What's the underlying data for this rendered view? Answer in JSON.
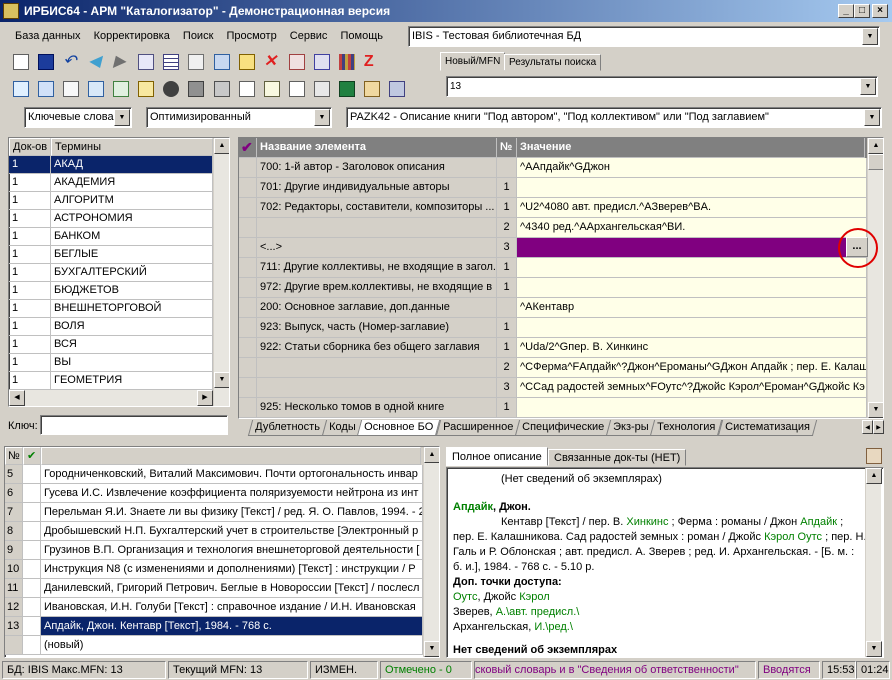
{
  "window": {
    "title": "ИРБИС64 - АРМ \"Каталогизатор\" - Демонстрационная версия",
    "min": "_",
    "max": "□",
    "close": "×"
  },
  "menu": [
    "База данных",
    "Корректировка",
    "Поиск",
    "Просмотр",
    "Сервис",
    "Помощь"
  ],
  "db_selector": {
    "value": "IBIS - Тестовая библиотечная БД"
  },
  "right_tabs": {
    "items": [
      "Новый/MFN",
      "Результаты поиска"
    ]
  },
  "mfn_input": {
    "value": "13"
  },
  "search_bar": {
    "mode": "Ключевые слова",
    "option": "Оптимизированный",
    "worksheet": "PAZK42 - Описание книги \"Под автором\", \"Под коллективом\" или \"Под заглавием\""
  },
  "dictionary": {
    "headers": {
      "count": "Док-ов",
      "terms": "Термины"
    },
    "rows": [
      {
        "count": "1",
        "term": "АКАД"
      },
      {
        "count": "1",
        "term": "АКАДЕМИЯ"
      },
      {
        "count": "1",
        "term": "АЛГОРИТМ"
      },
      {
        "count": "1",
        "term": "АСТРОНОМИЯ"
      },
      {
        "count": "1",
        "term": "БАНКОМ"
      },
      {
        "count": "1",
        "term": "БЕГЛЫЕ"
      },
      {
        "count": "1",
        "term": "БУХГАЛТЕРСКИЙ"
      },
      {
        "count": "1",
        "term": "БЮДЖЕТОВ"
      },
      {
        "count": "1",
        "term": "ВНЕШНЕТОРГОВОЙ"
      },
      {
        "count": "1",
        "term": "ВОЛЯ"
      },
      {
        "count": "1",
        "term": "ВСЯ"
      },
      {
        "count": "1",
        "term": "ВЫ"
      },
      {
        "count": "1",
        "term": "ГЕОМЕТРИЯ"
      }
    ],
    "key_label": "Ключ:",
    "key_value": ""
  },
  "editor": {
    "headers": {
      "check": "✔",
      "name": "Название элемента",
      "num": "№",
      "value": "Значение"
    },
    "rows": [
      {
        "name": "700: 1-й автор - Заголовок описания",
        "num": "",
        "value": "^AАпдайк^GДжон"
      },
      {
        "name": "701: Другие индивидуальные авторы",
        "num": "1",
        "value": ""
      },
      {
        "name": "702: Редакторы, составители, композиторы ...",
        "num": "1",
        "value": "^U2^4080 авт. предисл.^AЗверев^BA."
      },
      {
        "name": "",
        "num": "2",
        "value": "^4340 ред.^AАрхангельская^BИ."
      },
      {
        "name": "<...>",
        "num": "3",
        "value": ""
      },
      {
        "name": "711: Другие коллективы, не входящие в загол...",
        "num": "1",
        "value": ""
      },
      {
        "name": "972: Другие врем.коллективы, не входящие в ...",
        "num": "1",
        "value": ""
      },
      {
        "name": "200: Основное заглавие, доп.данные",
        "num": "",
        "value": "^AКентавр"
      },
      {
        "name": "923: Выпуск, часть (Номер-заглавие)",
        "num": "1",
        "value": ""
      },
      {
        "name": "922: Статьи сборника без общего заглавия",
        "num": "1",
        "value": "^Uda/2^Gпер. В. Хинкинс"
      },
      {
        "name": "",
        "num": "2",
        "value": "^CФерма^FАпдайк^?Джон^Eроманы^GДжон Апдайк ; пер. Е. Калашн"
      },
      {
        "name": "",
        "num": "3",
        "value": "^CСад радостей земных^FОутс^?Джойс Кэрол^Eроман^GДжойс Кэ"
      },
      {
        "name": "925: Несколько томов в одной книге",
        "num": "1",
        "value": ""
      }
    ],
    "ellipsis_button": "...",
    "tabs": [
      "Дублетность",
      "Коды",
      "Основное БО",
      "Расширенное",
      "Специфические",
      "Экз-ры",
      "Технология",
      "Систематизация"
    ],
    "active_tab": "Основное БО"
  },
  "results": {
    "headers": {
      "num": "№",
      "check": "✔"
    },
    "rows": [
      {
        "num": "5",
        "text": "Городниченковский, Виталий Максимович. Почти ортогональность инвар"
      },
      {
        "num": "6",
        "text": "Гусева И.С. Извлечение коэффициента поляризуемости нейтрона из инт"
      },
      {
        "num": "7",
        "text": "Перельман Я.И. Знаете ли вы физику [Текст] / ред. Я. О. Павлов, 1994. - 2"
      },
      {
        "num": "8",
        "text": "Дробышевский Н.П. Бухгалтерский учет в строительстве [Электронный р"
      },
      {
        "num": "9",
        "text": "Грузинов В.П. Организация и технология внешнеторговой деятельности ["
      },
      {
        "num": "10",
        "text": "Инструкция N8  (с изменениями и дополнениями) [Текст] : инструкции / Р"
      },
      {
        "num": "11",
        "text": "Данилевский, Григорий Петрович. Беглые в Новороссии [Текст] / послесл"
      },
      {
        "num": "12",
        "text": "Ивановская, И.Н. Голуби [Текст] : справочное издание / И.Н. Ивановская"
      },
      {
        "num": "13",
        "text": "Апдайк, Джон. Кентавр [Текст], 1984. - 768 с."
      },
      {
        "num": "",
        "text": "(новый)"
      }
    ],
    "selected_index": 8
  },
  "description": {
    "tabs": [
      "Полное описание",
      "Связанные док-ты (НЕТ)"
    ],
    "no_copies": "(Нет сведений об экземплярах)",
    "author_head": "Апдайк",
    "author_first": ", Джон.",
    "l1a": "Кентавр [Текст] / пер. В. ",
    "l1b": "Хинкинс",
    "l1c": " ; Ферма : романы / Джон ",
    "l1d": "Апдайк",
    "l1e": " ;",
    "l2a": "пер. Е. Калашникова. Сад радостей земных : роман / Джойс ",
    "l2b": "Кэрол Оутс",
    "l2c": " ; пер. Н.",
    "l3": "Галь и Р. Облонская ; авт. предисл. А. Зверев ; ред. И. Архангельская. - [Б. м. :",
    "l4": "б. и.], 1984. - 768 с. - 5.10 р.",
    "access_points": "Доп. точки доступа:",
    "ap1a": "Оутс",
    "ap1b": ", Джойс ",
    "ap1c": "Кэрол",
    "ap2a": "Зверев, ",
    "ap2b": "А.\\авт. предисл.\\",
    "ap3a": "Архангельская, ",
    "ap3b": "И.\\ред.\\",
    "no_copies_bottom": "Нет сведений об экземплярах"
  },
  "status": {
    "db": "БД: IBIS Макс.MFN: 13",
    "current": "Текущий MFN: 13",
    "changed": "ИЗМЕН.",
    "marked": "Отмечено - 0",
    "ticker": "сковый словарь и в \"Сведения об ответственности\"",
    "entered": "Вводятся",
    "time": "15:53",
    "time2": "01:24"
  },
  "colors": {
    "selection": "#0a246a",
    "editor_active_row": "#800080",
    "highlight_circle": "#e00000",
    "value_bg": "#ffffe8"
  }
}
